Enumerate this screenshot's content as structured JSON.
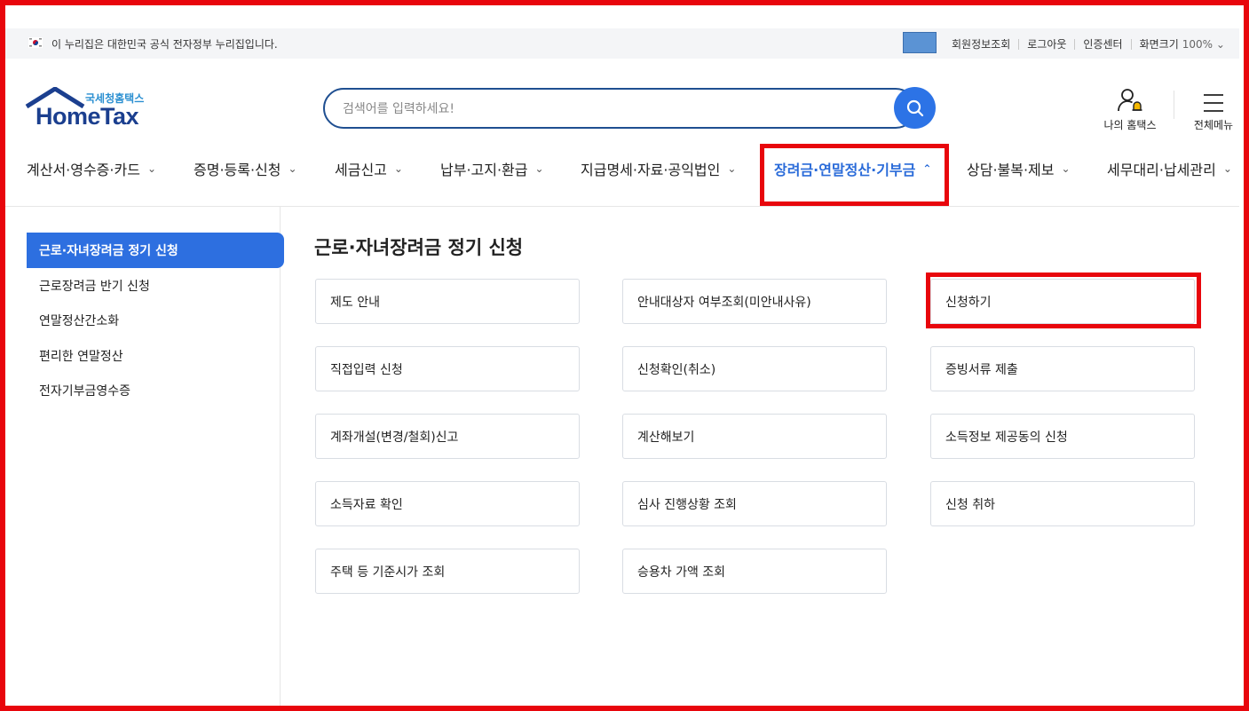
{
  "topbar": {
    "notice": "이 누리집은 대한민국 공식 전자정부 누리집입니다.",
    "links": [
      "회원정보조회",
      "로그아웃",
      "인증센터",
      "화면크기"
    ],
    "zoom": "100%"
  },
  "logo": {
    "sub": "국세청홈택스",
    "main": "HomeTax"
  },
  "search": {
    "placeholder": "검색어를 입력하세요!"
  },
  "utils": {
    "my": "나의 홈택스",
    "all": "전체메뉴"
  },
  "gnb": [
    {
      "label": "계산서·영수증·카드",
      "active": false
    },
    {
      "label": "증명·등록·신청",
      "active": false
    },
    {
      "label": "세금신고",
      "active": false
    },
    {
      "label": "납부·고지·환급",
      "active": false
    },
    {
      "label": "지급명세·자료·공익법인",
      "active": false
    },
    {
      "label": "장려금·연말정산·기부금",
      "active": true
    },
    {
      "label": "상담·불복·제보",
      "active": false
    },
    {
      "label": "세무대리·납세관리",
      "active": false
    }
  ],
  "lnb": [
    {
      "label": "근로·자녀장려금 정기 신청",
      "active": true
    },
    {
      "label": "근로장려금 반기 신청",
      "active": false
    },
    {
      "label": "연말정산간소화",
      "active": false
    },
    {
      "label": "편리한 연말정산",
      "active": false
    },
    {
      "label": "전자기부금영수증",
      "active": false
    }
  ],
  "content": {
    "title": "근로·자녀장려금 정기 신청",
    "cards": [
      "제도 안내",
      "안내대상자 여부조회(미안내사유)",
      "신청하기",
      "직접입력 신청",
      "신청확인(취소)",
      "증빙서류 제출",
      "계좌개설(변경/철회)신고",
      "계산해보기",
      "소득정보 제공동의 신청",
      "소득자료 확인",
      "심사 진행상황 조회",
      "신청 취하",
      "주택 등 기준시가 조회",
      "승용차 가액 조회"
    ]
  },
  "colors": {
    "accent": "#2d6fe0",
    "highlight": "#e8060c",
    "navy": "#1b3f8f"
  }
}
